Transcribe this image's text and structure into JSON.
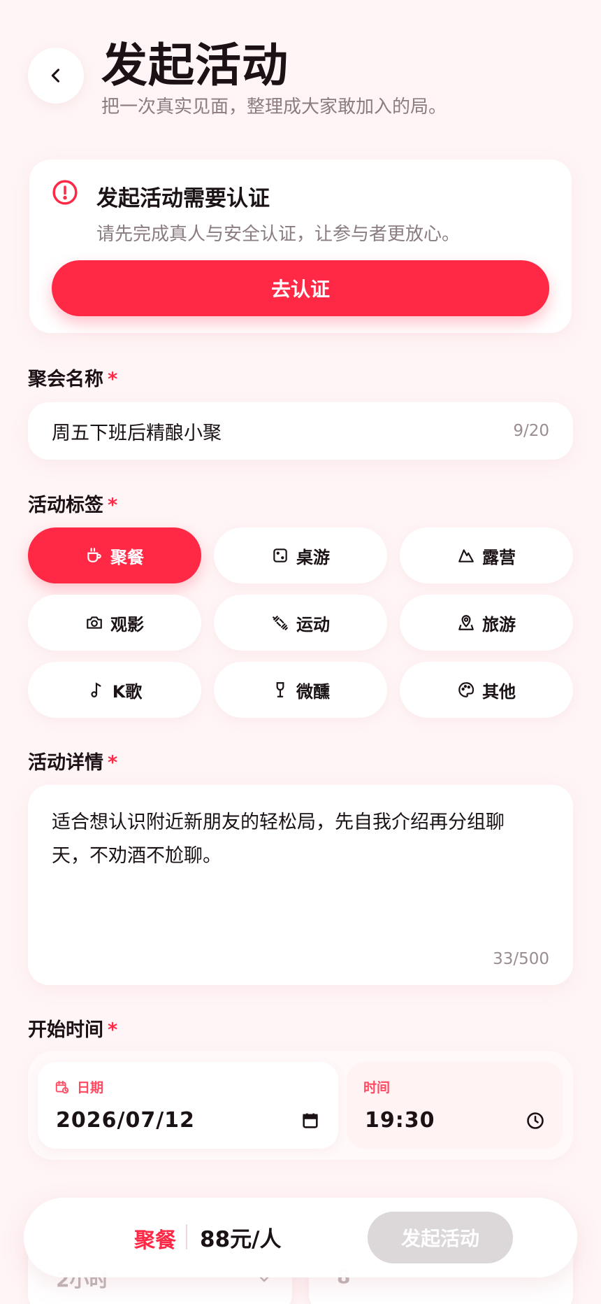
{
  "header": {
    "title": "发起活动",
    "subtitle": "把一次真实见面，整理成大家敢加入的局。",
    "back_icon": "chevron-left-icon"
  },
  "verify": {
    "title": "发起活动需要认证",
    "desc": "请先完成真人与安全认证，让参与者更放心。",
    "button": "去认证",
    "icon": "alert-circle-icon"
  },
  "name": {
    "label": "聚会名称",
    "required": "*",
    "value": "周五下班后精酿小聚",
    "counter": "9/20"
  },
  "tags": {
    "label": "活动标签",
    "required": "*",
    "items": [
      {
        "label": "聚餐",
        "icon": "coffee-cup-icon",
        "active": true
      },
      {
        "label": "桌游",
        "icon": "dice-icon",
        "active": false
      },
      {
        "label": "露营",
        "icon": "mountain-icon",
        "active": false
      },
      {
        "label": "观影",
        "icon": "camera-icon",
        "active": false
      },
      {
        "label": "运动",
        "icon": "dumbbell-icon",
        "active": false
      },
      {
        "label": "旅游",
        "icon": "map-pin-icon",
        "active": false
      },
      {
        "label": "K歌",
        "icon": "music-note-icon",
        "active": false
      },
      {
        "label": "微醺",
        "icon": "wine-glass-icon",
        "active": false
      },
      {
        "label": "其他",
        "icon": "palette-icon",
        "active": false
      }
    ]
  },
  "detail": {
    "label": "活动详情",
    "required": "*",
    "value": "适合想认识附近新朋友的轻松局，先自我介绍再分组聊天，不劝酒不尬聊。",
    "counter": "33/500"
  },
  "start_time": {
    "label": "开始时间",
    "required": "*",
    "date_label": "日期",
    "date_value": "2026/07/12",
    "time_label": "时间",
    "time_value": "19:30"
  },
  "partial_row": {
    "duration": "2小时",
    "count": "8"
  },
  "bottom_bar": {
    "tag": "聚餐",
    "price": "88元/人",
    "submit": "发起活动"
  },
  "colors": {
    "accent": "#ff2845",
    "background": "#fff5f6",
    "muted_text": "#8b7c80",
    "disabled": "#dcd7d9"
  }
}
